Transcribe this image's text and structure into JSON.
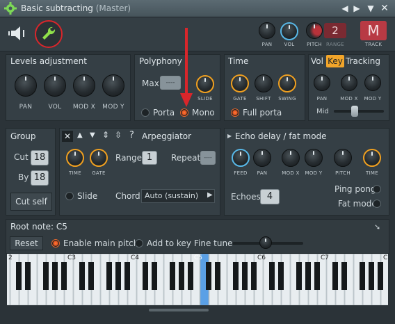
{
  "window": {
    "title": "Basic subtracting",
    "subtitle": "(Master)"
  },
  "toolbar": {
    "knobs": [
      "PAN",
      "VOL",
      "PITCH"
    ],
    "range_label": "RANGE",
    "range_value": "2",
    "track_label": "TRACK",
    "track_value": "M"
  },
  "levels": {
    "title": "Levels adjustment",
    "knobs": [
      "PAN",
      "VOL",
      "MOD X",
      "MOD Y"
    ]
  },
  "polyphony": {
    "title": "Polyphony",
    "max_label": "Max",
    "max_value": "----",
    "slide_label": "SLIDE",
    "porta_label": "Porta",
    "mono_label": "Mono"
  },
  "time": {
    "title": "Time",
    "knobs": [
      "GATE",
      "SHIFT",
      "SWING"
    ],
    "full_porta_label": "Full porta"
  },
  "tracking": {
    "vol_tab": "Vol",
    "key_tab": "Key",
    "tracking_label": "Tracking",
    "knobs": [
      "PAN",
      "MOD X",
      "MOD Y"
    ],
    "mid_label": "Mid"
  },
  "group": {
    "title": "Group",
    "cut_label": "Cut",
    "cut_value": "18",
    "by_label": "By",
    "by_value": "18",
    "cut_self_label": "Cut self"
  },
  "arpeggiator": {
    "title": "Arpeggiator",
    "knobs": [
      "TIME",
      "GATE"
    ],
    "range_label": "Range",
    "range_value": "1",
    "repeat_label": "Repeat",
    "repeat_value": "----",
    "slide_label": "Slide",
    "chord_label": "Chord",
    "chord_value": "Auto (sustain)"
  },
  "echo": {
    "title": "Echo delay / fat mode",
    "knobs": [
      "FEED",
      "PAN",
      "MOD X",
      "MOD Y",
      "PITCH",
      "TIME"
    ],
    "echoes_label": "Echoes",
    "echoes_value": "4",
    "ping_pong_label": "Ping pong",
    "fat_mode_label": "Fat mode"
  },
  "root": {
    "title": "Root note: C5",
    "reset_label": "Reset",
    "enable_label": "Enable main pitch",
    "add_key_label": "Add to key",
    "fine_tune_label": "Fine tune"
  },
  "piano": {
    "octave_labels": [
      "2",
      "C3",
      "C4",
      "C5",
      "C6",
      "C7",
      "C"
    ],
    "highlighted": "C5"
  },
  "colors": {
    "accent_orange": "#f0a020",
    "accent_blue": "#58b8e8",
    "radio_on": "#e2521c",
    "annotation_red": "#d9262b",
    "key_highlight": "#5aa0e6"
  }
}
